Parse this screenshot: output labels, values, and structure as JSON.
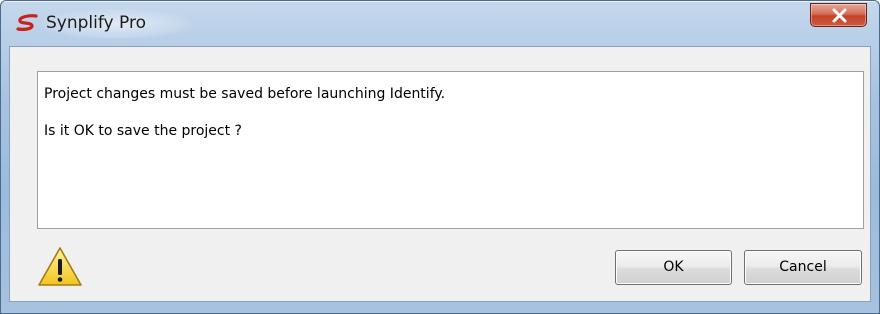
{
  "window": {
    "title": "Synplify Pro",
    "app_icon": "synplify-logo-icon",
    "close_icon": "close-icon"
  },
  "message": {
    "line1": "Project changes must be saved before launching Identify.",
    "line2": "Is it OK to save the project ?"
  },
  "warning_icon": "warning-icon",
  "buttons": {
    "ok_label": "OK",
    "cancel_label": "Cancel"
  },
  "colors": {
    "title_bar": "#a9c4e2",
    "close_button": "#c2422a",
    "dialog_background": "#f0f0f0",
    "warning_fill": "#f7d33c"
  }
}
